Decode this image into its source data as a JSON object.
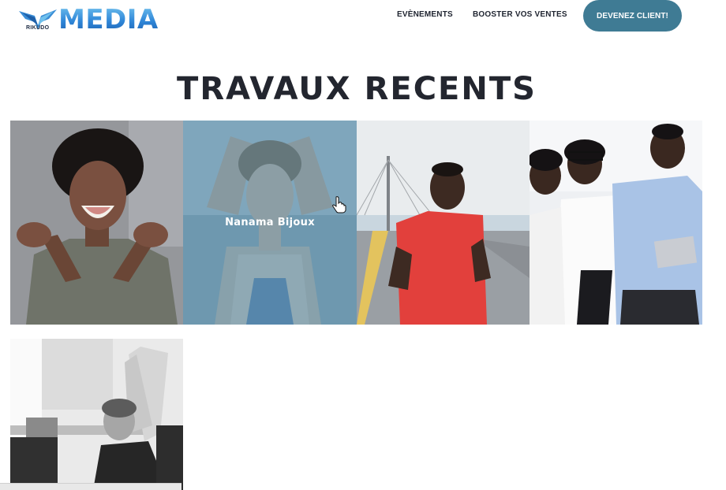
{
  "header": {
    "logo": {
      "text": "MEDIA",
      "sub": "RIKUDO"
    },
    "nav": [
      {
        "label": "EVÈNEMENTS"
      },
      {
        "label": "BOOSTER VOS VENTES"
      }
    ],
    "cta_label": "DEVENEZ CLIENT!"
  },
  "section": {
    "title": "TRAVAUX RECENTS"
  },
  "portfolio": {
    "items": [
      {
        "image": "woman-pointing-photo"
      },
      {
        "image": "woman-hair-photo",
        "hover_label": "Nanama Bijoux"
      },
      {
        "image": "man-running-bridge-photo"
      },
      {
        "image": "business-team-tablet-photo"
      },
      {
        "image": "man-stretching-office-photo"
      }
    ]
  },
  "colors": {
    "cta": "#3f7b94",
    "title": "#23262f",
    "overlay": "#4680a0",
    "logo": "#2f86d8"
  },
  "icons": [
    "logo-wings-icon",
    "hand-pointer-cursor-icon"
  ]
}
